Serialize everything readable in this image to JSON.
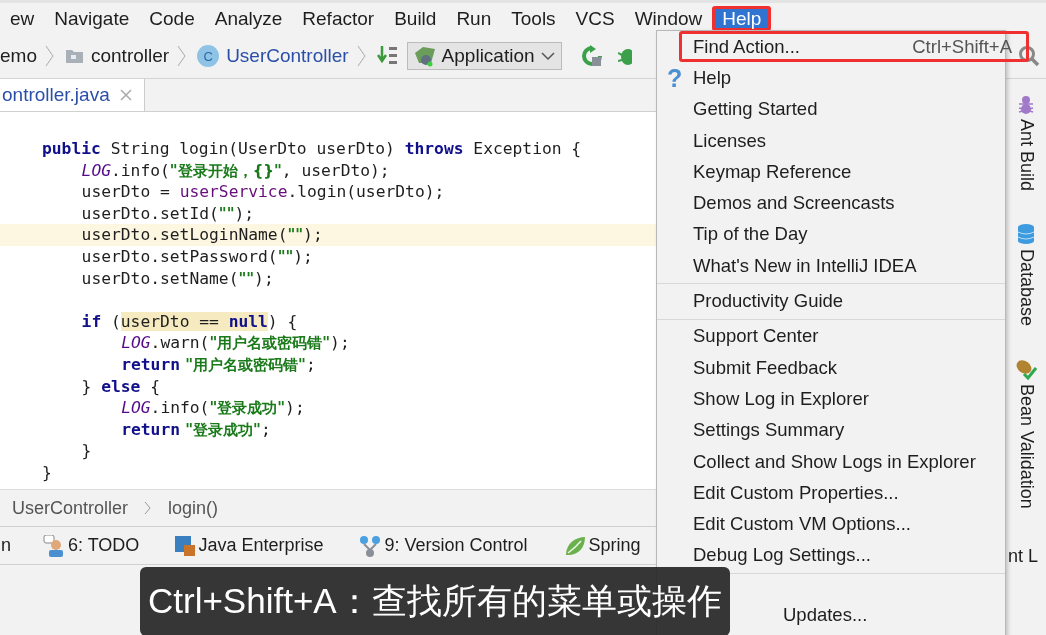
{
  "menu_bar": [
    {
      "label": "ew",
      "selected": false,
      "outlined": false
    },
    {
      "label": "Navigate",
      "selected": false,
      "outlined": false
    },
    {
      "label": "Code",
      "selected": false,
      "outlined": false
    },
    {
      "label": "Analyze",
      "selected": false,
      "outlined": false
    },
    {
      "label": "Refactor",
      "selected": false,
      "outlined": false
    },
    {
      "label": "Build",
      "selected": false,
      "outlined": false
    },
    {
      "label": "Run",
      "selected": false,
      "outlined": false
    },
    {
      "label": "Tools",
      "selected": false,
      "outlined": false
    },
    {
      "label": "VCS",
      "selected": false,
      "outlined": false
    },
    {
      "label": "Window",
      "selected": false,
      "outlined": false
    },
    {
      "label": "Help",
      "selected": true,
      "outlined": true
    }
  ],
  "nav_bar": {
    "breadcrumbs": [
      {
        "label": "emo",
        "kind": "plain"
      },
      {
        "label": "controller",
        "kind": "folder"
      },
      {
        "label": "UserController",
        "kind": "class",
        "icon_letter": "C"
      }
    ],
    "run_config": "Application"
  },
  "editor_tab": {
    "label": "ontroller.java"
  },
  "code_lines": [
    {
      "kind": "code",
      "current": false,
      "tokens": [
        {
          "text": "public",
          "kind": "keyword"
        },
        {
          "text": " String login(UserDto userDto) ",
          "kind": "plain"
        },
        {
          "text": "throws",
          "kind": "keyword"
        },
        {
          "text": " Exception {",
          "kind": "plain"
        }
      ],
      "children": [
        {
          "kind": "code",
          "current": false,
          "tokens": [
            {
              "text": "LOG",
              "kind": "static"
            },
            {
              "text": ".info(",
              "kind": "plain"
            },
            {
              "text": "\"登录开始，{}\"",
              "kind": "string"
            },
            {
              "text": ", userDto);",
              "kind": "plain"
            }
          ]
        },
        {
          "kind": "code",
          "current": false,
          "tokens": [
            {
              "text": "userDto = ",
              "kind": "plain"
            },
            {
              "text": "userService",
              "kind": "field"
            },
            {
              "text": ".login(userDto);",
              "kind": "plain"
            }
          ]
        },
        {
          "kind": "code",
          "current": false,
          "tokens": [
            {
              "text": "userDto.setId(",
              "kind": "plain"
            },
            {
              "text": "\"\"",
              "kind": "string"
            },
            {
              "text": ");",
              "kind": "plain"
            }
          ]
        },
        {
          "kind": "code",
          "current": true,
          "tokens": [
            {
              "text": "userDto.setLoginName(",
              "kind": "plain"
            },
            {
              "text": "\"\"",
              "kind": "string"
            },
            {
              "text": ");",
              "kind": "plain"
            }
          ]
        },
        {
          "kind": "code",
          "current": false,
          "tokens": [
            {
              "text": "userDto.setPassword(",
              "kind": "plain"
            },
            {
              "text": "\"\"",
              "kind": "string"
            },
            {
              "text": ");",
              "kind": "plain"
            }
          ]
        },
        {
          "kind": "code",
          "current": false,
          "tokens": [
            {
              "text": "userDto.setName(",
              "kind": "plain"
            },
            {
              "text": "\"\"",
              "kind": "string"
            },
            {
              "text": ");",
              "kind": "plain"
            }
          ]
        },
        {
          "kind": "blank",
          "current": false
        },
        {
          "kind": "code",
          "current": false,
          "tokens": [
            {
              "text": "if",
              "kind": "keyword"
            },
            {
              "text": " (",
              "kind": "plain"
            },
            {
              "text": "userDto == ",
              "kind": "highlight"
            },
            {
              "text": "null",
              "kind": "highlight-keyword"
            },
            {
              "text": ") {",
              "kind": "plain"
            }
          ],
          "children": [
            {
              "kind": "code",
              "current": false,
              "tokens": [
                {
                  "text": "LOG",
                  "kind": "static"
                },
                {
                  "text": ".warn(",
                  "kind": "plain"
                },
                {
                  "text": "\"用户名或密码错\"",
                  "kind": "string"
                },
                {
                  "text": ");",
                  "kind": "plain"
                }
              ]
            },
            {
              "kind": "code",
              "current": false,
              "tokens": [
                {
                  "text": "return",
                  "kind": "keyword"
                },
                {
                  "text": " \"用户名或密码错\"",
                  "kind": "string"
                },
                {
                  "text": ";",
                  "kind": "plain"
                }
              ]
            }
          ]
        },
        {
          "kind": "code",
          "current": false,
          "tokens": [
            {
              "text": "} ",
              "kind": "plain"
            },
            {
              "text": "else",
              "kind": "keyword"
            },
            {
              "text": " {",
              "kind": "plain"
            }
          ],
          "children": [
            {
              "kind": "code",
              "current": false,
              "tokens": [
                {
                  "text": "LOG",
                  "kind": "static"
                },
                {
                  "text": ".info(",
                  "kind": "plain"
                },
                {
                  "text": "\"登录成功\"",
                  "kind": "string"
                },
                {
                  "text": ");",
                  "kind": "plain"
                }
              ]
            },
            {
              "kind": "code",
              "current": false,
              "tokens": [
                {
                  "text": "return",
                  "kind": "keyword"
                },
                {
                  "text": " \"登录成功\"",
                  "kind": "string"
                },
                {
                  "text": ";",
                  "kind": "plain"
                }
              ]
            }
          ]
        },
        {
          "kind": "code",
          "current": false,
          "tokens": [
            {
              "text": "}",
              "kind": "plain"
            }
          ]
        }
      ]
    },
    {
      "kind": "code",
      "current": false,
      "tokens": [
        {
          "text": "}",
          "kind": "plain"
        }
      ]
    }
  ],
  "breadcrumb_bar": [
    "UserController",
    "login()"
  ],
  "tool_windows": [
    {
      "label": "n",
      "kind": "plain"
    },
    {
      "label": "6: TODO",
      "kind": "todo"
    },
    {
      "label": "Java Enterprise",
      "kind": "javaee"
    },
    {
      "label": "9: Version Control",
      "kind": "vcs"
    },
    {
      "label": "Spring",
      "kind": "spring"
    }
  ],
  "right_strip": [
    {
      "label": "Ant Build",
      "kind": "ant"
    },
    {
      "label": "Database",
      "kind": "database"
    },
    {
      "label": "Bean Validation",
      "kind": "bean"
    },
    {
      "label": "nt L",
      "kind": "text"
    }
  ],
  "help_menu": [
    {
      "label": "Find Action...",
      "shortcut": "Ctrl+Shift+A",
      "kind": "item",
      "outlined": true
    },
    {
      "label": "Help",
      "kind": "help",
      "icon": "?",
      "outlined": false
    },
    {
      "label": "Getting Started",
      "kind": "item",
      "outlined": false
    },
    {
      "label": "Licenses",
      "kind": "item",
      "outlined": false
    },
    {
      "label": "Keymap Reference",
      "kind": "item",
      "outlined": false
    },
    {
      "label": "Demos and Screencasts",
      "kind": "item",
      "outlined": false
    },
    {
      "label": "Tip of the Day",
      "kind": "item",
      "outlined": false
    },
    {
      "label": "What's New in IntelliJ IDEA",
      "kind": "item",
      "outlined": false
    },
    {
      "kind": "separator"
    },
    {
      "label": "Productivity Guide",
      "kind": "item",
      "outlined": false
    },
    {
      "kind": "separator"
    },
    {
      "label": "Support Center",
      "kind": "item",
      "outlined": false
    },
    {
      "label": "Submit Feedback",
      "kind": "item",
      "outlined": false
    },
    {
      "label": "Show Log in Explorer",
      "kind": "item",
      "outlined": false
    },
    {
      "label": "Settings Summary",
      "kind": "item",
      "outlined": false
    },
    {
      "label": "Collect and Show Logs in Explorer",
      "kind": "item",
      "outlined": false
    },
    {
      "label": "Edit Custom Properties...",
      "kind": "item",
      "outlined": false
    },
    {
      "label": "Edit Custom VM Options...",
      "kind": "item",
      "outlined": false
    },
    {
      "label": "Debug Log Settings...",
      "kind": "item",
      "outlined": false
    },
    {
      "kind": "separator"
    },
    {
      "label": "Updates...",
      "kind": "covered",
      "outlined": false
    }
  ],
  "caption": "Ctrl+Shift+A：查找所有的菜单或操作"
}
